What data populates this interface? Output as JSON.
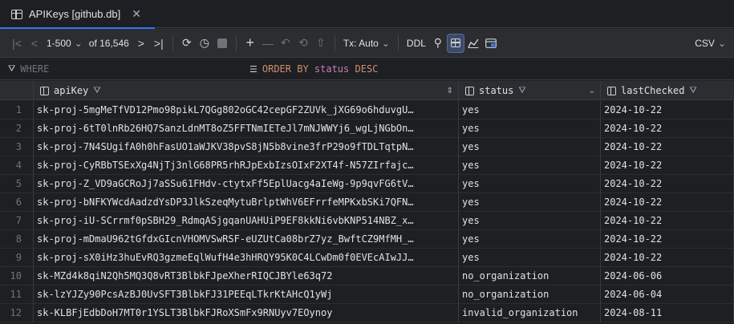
{
  "tab": {
    "title": "APIKeys [github.db]",
    "close": "✕"
  },
  "toolbar": {
    "first": "|<",
    "prev": "<",
    "range": "1-500",
    "range_caret": "⌄",
    "of_count": "of 16,546",
    "next": ">",
    "last": ">|",
    "reload": "⟳",
    "history": "◷",
    "add": "+",
    "remove": "—",
    "revert": "↶",
    "rollback": "⟲",
    "submit": "⇧",
    "tx_label": "Tx: Auto",
    "tx_caret": "⌄",
    "ddl": "DDL",
    "search": "⚲",
    "export": "CSV",
    "export_caret": "⌄"
  },
  "filter": {
    "where_placeholder": "WHERE",
    "order_kw": "ORDER BY",
    "order_col": "status",
    "order_dir": "DESC"
  },
  "table": {
    "columns": [
      {
        "name": "apiKey"
      },
      {
        "name": "status"
      },
      {
        "name": "lastChecked"
      }
    ],
    "rows": [
      {
        "n": "1",
        "apiKey": "sk-proj-5mgMeTfVD12Pmo98pikL7QGg802oGC42cepGF2ZUVk_jXG69o6hduvgU…",
        "status": "yes",
        "lastChecked": "2024-10-22"
      },
      {
        "n": "2",
        "apiKey": "sk-proj-6tT0lnRb26HQ7SanzLdnMT8oZ5FFTNmIETeJl7mNJWWYj6_wgLjNGbOn…",
        "status": "yes",
        "lastChecked": "2024-10-22"
      },
      {
        "n": "3",
        "apiKey": "sk-proj-7N4SUgifA0h0hFasUO1aWJKV38pvS8jN5b8vine3frP29o9fTDLTqtpN…",
        "status": "yes",
        "lastChecked": "2024-10-22"
      },
      {
        "n": "4",
        "apiKey": "sk-proj-CyRBbTSExXg4NjTj3nlG68PR5rhRJpExbIzsOIxF2XT4f-N57ZIrfajc…",
        "status": "yes",
        "lastChecked": "2024-10-22"
      },
      {
        "n": "5",
        "apiKey": "sk-proj-Z_VD9aGCRoJj7aSSu61FHdv-ctytxFf5EplUacg4aIeWg-9p9qvFG6tV…",
        "status": "yes",
        "lastChecked": "2024-10-22"
      },
      {
        "n": "6",
        "apiKey": "sk-proj-bNFKYWcdAadzdYsDP3JlkSzeqMytuBrlptWhV6EFrrfeMPKxbSKi7QFN…",
        "status": "yes",
        "lastChecked": "2024-10-22"
      },
      {
        "n": "7",
        "apiKey": "sk-proj-iU-SCrrmf0pSBH29_RdmqASjgqanUAHUiP9EF8kkNi6vbKNP514NBZ_x…",
        "status": "yes",
        "lastChecked": "2024-10-22"
      },
      {
        "n": "8",
        "apiKey": "sk-proj-mDmaU962tGfdxGIcnVHOMVSwRSF-eUZUtCa08brZ7yz_BwftCZ9MfMH_…",
        "status": "yes",
        "lastChecked": "2024-10-22"
      },
      {
        "n": "9",
        "apiKey": "sk-proj-sX0iHz3huEvRQ3gzmeEqlWufH4e3hHRQY95K0C4LCwDm0f0EVEcAIwJJ…",
        "status": "yes",
        "lastChecked": "2024-10-22"
      },
      {
        "n": "10",
        "apiKey": "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",
        "status": "no_organization",
        "lastChecked": "2024-06-06"
      },
      {
        "n": "11",
        "apiKey": "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",
        "status": "no_organization",
        "lastChecked": "2024-06-04"
      },
      {
        "n": "12",
        "apiKey": "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",
        "status": "invalid_organization",
        "lastChecked": "2024-08-11"
      }
    ]
  }
}
